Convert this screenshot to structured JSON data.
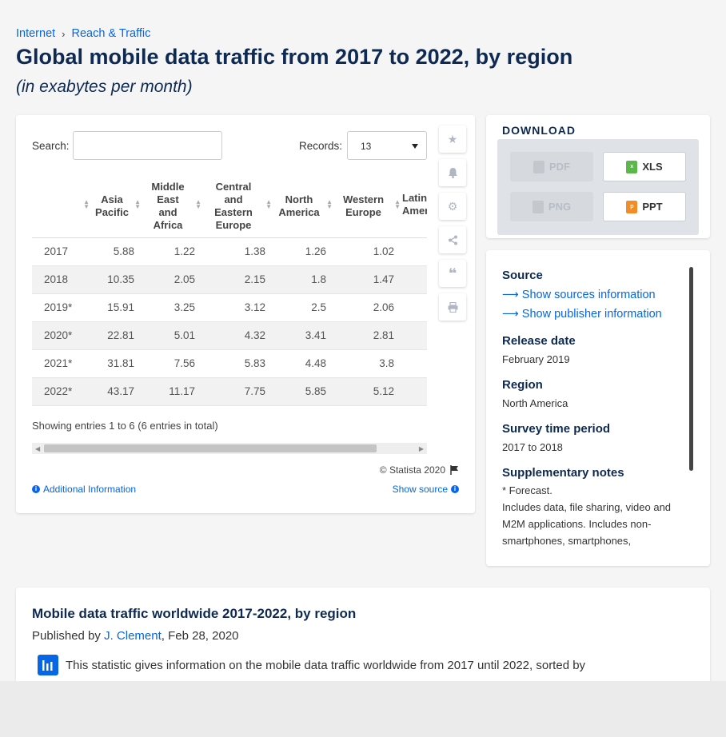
{
  "breadcrumb": {
    "item1": "Internet",
    "sep": "›",
    "item2": "Reach & Traffic"
  },
  "title": "Global mobile data traffic from 2017 to 2022, by region",
  "subtitle": "(in exabytes per month)",
  "controls": {
    "search_label": "Search:",
    "records_label": "Records:",
    "records_value": "13"
  },
  "table": {
    "headers": [
      "",
      "Asia Pacific",
      "Middle East and Africa",
      "Central and Eastern Europe",
      "North America",
      "Western Europe",
      "Latin America"
    ],
    "visible_headers": [
      "",
      "Asia\nPacific",
      "Middle\nEast\nand\nAfrica",
      "Central\nand\nEastern\nEurope",
      "North\nAmerica",
      "Western\nEurope",
      "L\nAm"
    ],
    "rows": [
      [
        "2017",
        "5.88",
        "1.22",
        "1.38",
        "1.26",
        "1.02"
      ],
      [
        "2018",
        "10.35",
        "2.05",
        "2.15",
        "1.8",
        "1.47"
      ],
      [
        "2019*",
        "15.91",
        "3.25",
        "3.12",
        "2.5",
        "2.06"
      ],
      [
        "2020*",
        "22.81",
        "5.01",
        "4.32",
        "3.41",
        "2.81"
      ],
      [
        "2021*",
        "31.81",
        "7.56",
        "5.83",
        "4.48",
        "3.8"
      ],
      [
        "2022*",
        "43.17",
        "11.17",
        "7.75",
        "5.85",
        "5.12"
      ]
    ]
  },
  "entries_text": "Showing entries 1 to 6 (6 entries in total)",
  "copyright": "© Statista 2020",
  "additional_info": "Additional Information",
  "show_source": "Show source",
  "download": {
    "title": "DOWNLOAD",
    "pdf": "PDF",
    "xls": "XLS",
    "png": "PNG",
    "ppt": "PPT"
  },
  "source_panel": {
    "source_label": "Source",
    "show_sources": "Show sources information",
    "show_publisher": "Show publisher information",
    "release_label": "Release date",
    "release_value": "February 2019",
    "region_label": "Region",
    "region_value": "North America",
    "survey_label": "Survey time period",
    "survey_value": "2017 to 2018",
    "notes_label": "Supplementary notes",
    "notes_value": "* Forecast.\nIncludes data, file sharing, video and M2M applications. Includes non-smartphones, smartphones,"
  },
  "bottom": {
    "title": "Mobile data traffic worldwide 2017-2022, by region",
    "published_by": "Published by ",
    "author": "J. Clement",
    "date": ", Feb 28, 2020",
    "description": "This statistic gives information on the mobile data traffic worldwide from 2017 until 2022, sorted by"
  },
  "colors": {
    "link": "#0666e5",
    "title": "#0f2a52",
    "xls": "#5bb749",
    "ppt": "#f28c28"
  },
  "icons": [
    "star-icon",
    "bell-icon",
    "gear-icon",
    "share-icon",
    "quote-icon",
    "print-icon",
    "flag-icon",
    "info-icon",
    "arrow-right-icon",
    "bar-chart-icon"
  ]
}
